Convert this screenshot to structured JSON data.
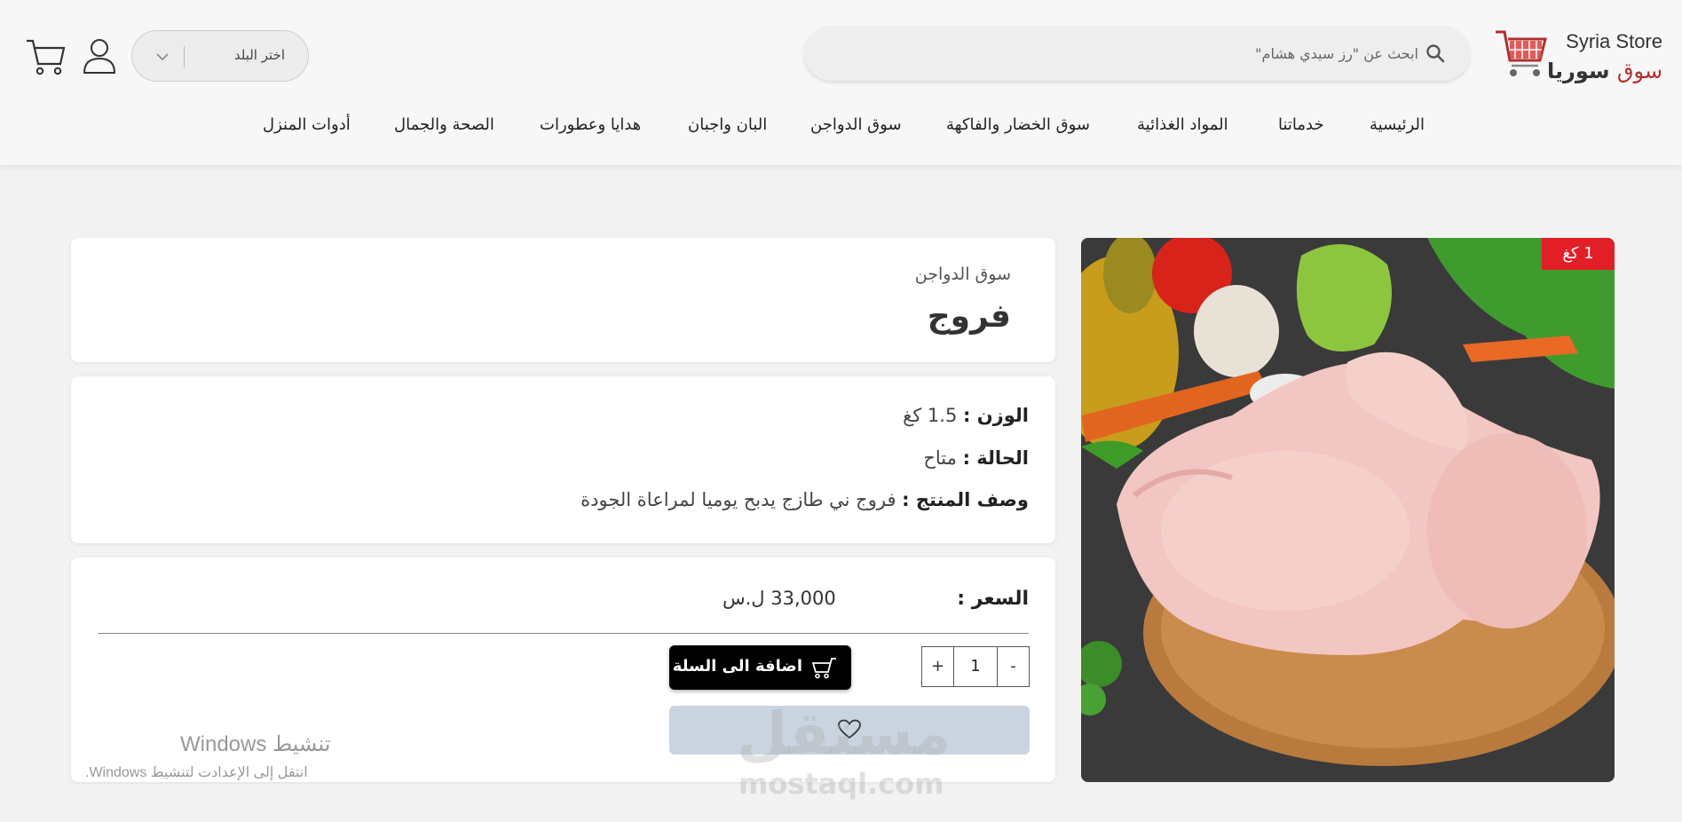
{
  "header": {
    "logo": {
      "en_prefix": "Syria",
      "en_suffix": "Store",
      "ar_red": "سوق",
      "ar_dark": "سوريا"
    },
    "search": {
      "placeholder": "ابحث عن \"رز سيدي هشام\""
    },
    "country_select": {
      "label": "اختر البلد"
    }
  },
  "nav": {
    "items": [
      {
        "label": "الرئيسية"
      },
      {
        "label": "خدماتنا"
      },
      {
        "label": "المواد الغذائية"
      },
      {
        "label": "سوق الخضار والفاكهة"
      },
      {
        "label": "سوق الدواجن"
      },
      {
        "label": "البان واجبان"
      },
      {
        "label": "هدايا وعطورات"
      },
      {
        "label": "الصحة والجمال"
      },
      {
        "label": "أدوات المنزل"
      }
    ]
  },
  "product": {
    "badge": "1 كغ",
    "category": "سوق الدواجن",
    "title": "فروج",
    "specs": [
      {
        "key": "الوزن :",
        "value": "1.5 كغ"
      },
      {
        "key": "الحالة :",
        "value": "متاح"
      },
      {
        "key": "وصف المنتج :",
        "value": "فروج ني طازج يدبح يوميا لمراعاة الجودة"
      }
    ],
    "price_label": "السعر :",
    "price_value": "33,000 ل.س",
    "quantity": {
      "minus": "-",
      "value": "1",
      "plus": "+"
    },
    "add_to_cart": "اضافة الى السلة"
  },
  "overlay": {
    "windows_title": "تنشيط Windows",
    "windows_sub": "انتقل إلى الإعدادت لتنشيط Windows.",
    "watermark_ar": "مستقل",
    "watermark_en": "mostaql.com"
  },
  "colors": {
    "accent_red": "#e21e26",
    "logo_red": "#b0302c",
    "wishlist_bg": "#cad4e1"
  }
}
